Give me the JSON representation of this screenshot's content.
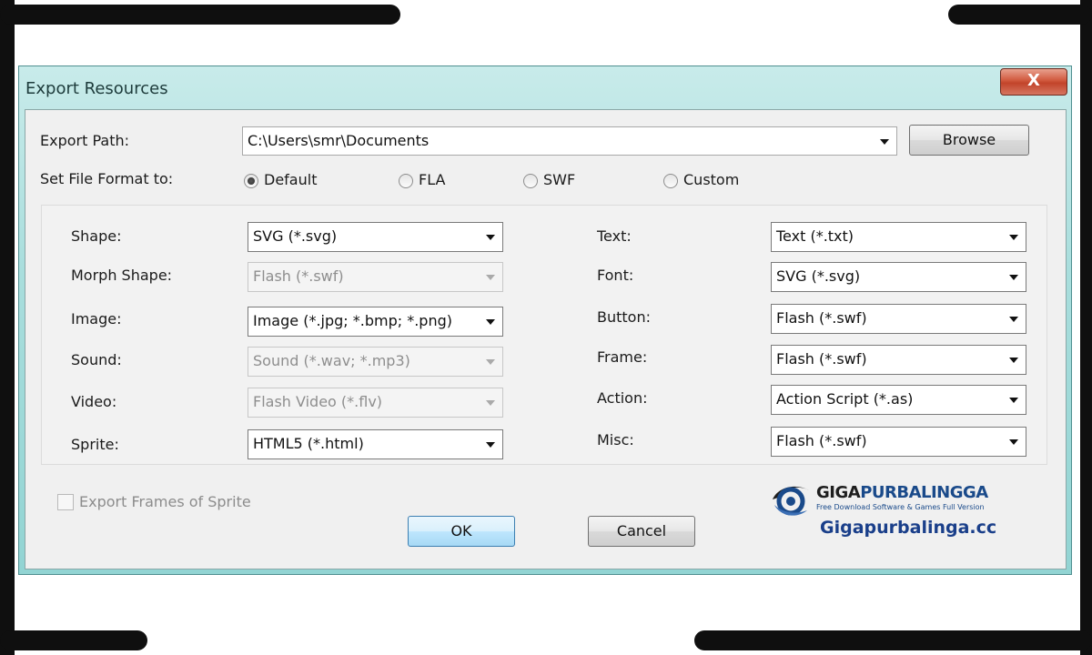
{
  "window": {
    "title": "Export  Resources",
    "close_label": "X"
  },
  "export_path": {
    "label": "Export Path:",
    "value": "C:\\Users\\smr\\Documents",
    "browse_label": "Browse"
  },
  "file_format": {
    "label": "Set File Format to:",
    "options": [
      "Default",
      "FLA",
      "SWF",
      "Custom"
    ],
    "selected": "Default"
  },
  "resources_left": [
    {
      "label": "Shape:",
      "value": "SVG (*.svg)",
      "enabled": true
    },
    {
      "label": "Morph Shape:",
      "value": "Flash (*.swf)",
      "enabled": false
    },
    {
      "label": "Image:",
      "value": "Image (*.jpg; *.bmp; *.png)",
      "enabled": true
    },
    {
      "label": "Sound:",
      "value": "Sound (*.wav; *.mp3)",
      "enabled": false
    },
    {
      "label": "Video:",
      "value": "Flash Video (*.flv)",
      "enabled": false
    },
    {
      "label": "Sprite:",
      "value": "HTML5 (*.html)",
      "enabled": true
    }
  ],
  "resources_right": [
    {
      "label": "Text:",
      "value": "Text (*.txt)",
      "enabled": true
    },
    {
      "label": "Font:",
      "value": "SVG (*.svg)",
      "enabled": true
    },
    {
      "label": "Button:",
      "value": "Flash (*.swf)",
      "enabled": true
    },
    {
      "label": "Frame:",
      "value": "Flash (*.swf)",
      "enabled": true
    },
    {
      "label": "Action:",
      "value": "Action Script (*.as)",
      "enabled": true
    },
    {
      "label": "Misc:",
      "value": "Flash (*.swf)",
      "enabled": true
    }
  ],
  "export_frames": {
    "label": "Export Frames of Sprite",
    "checked": false,
    "enabled": false
  },
  "buttons": {
    "ok": "OK",
    "cancel": "Cancel"
  },
  "watermark": {
    "brand_part1": "GIGA",
    "brand_part2": "PURBALINGGA",
    "tagline": "Free Download Software & Games Full Version",
    "site": "Gigapurbalinga.cc"
  },
  "colors": {
    "title_bar": "#a9dedd",
    "close_button": "#c2442a",
    "client_bg": "#f0f0f0",
    "default_button_border": "#3c7fb1"
  }
}
